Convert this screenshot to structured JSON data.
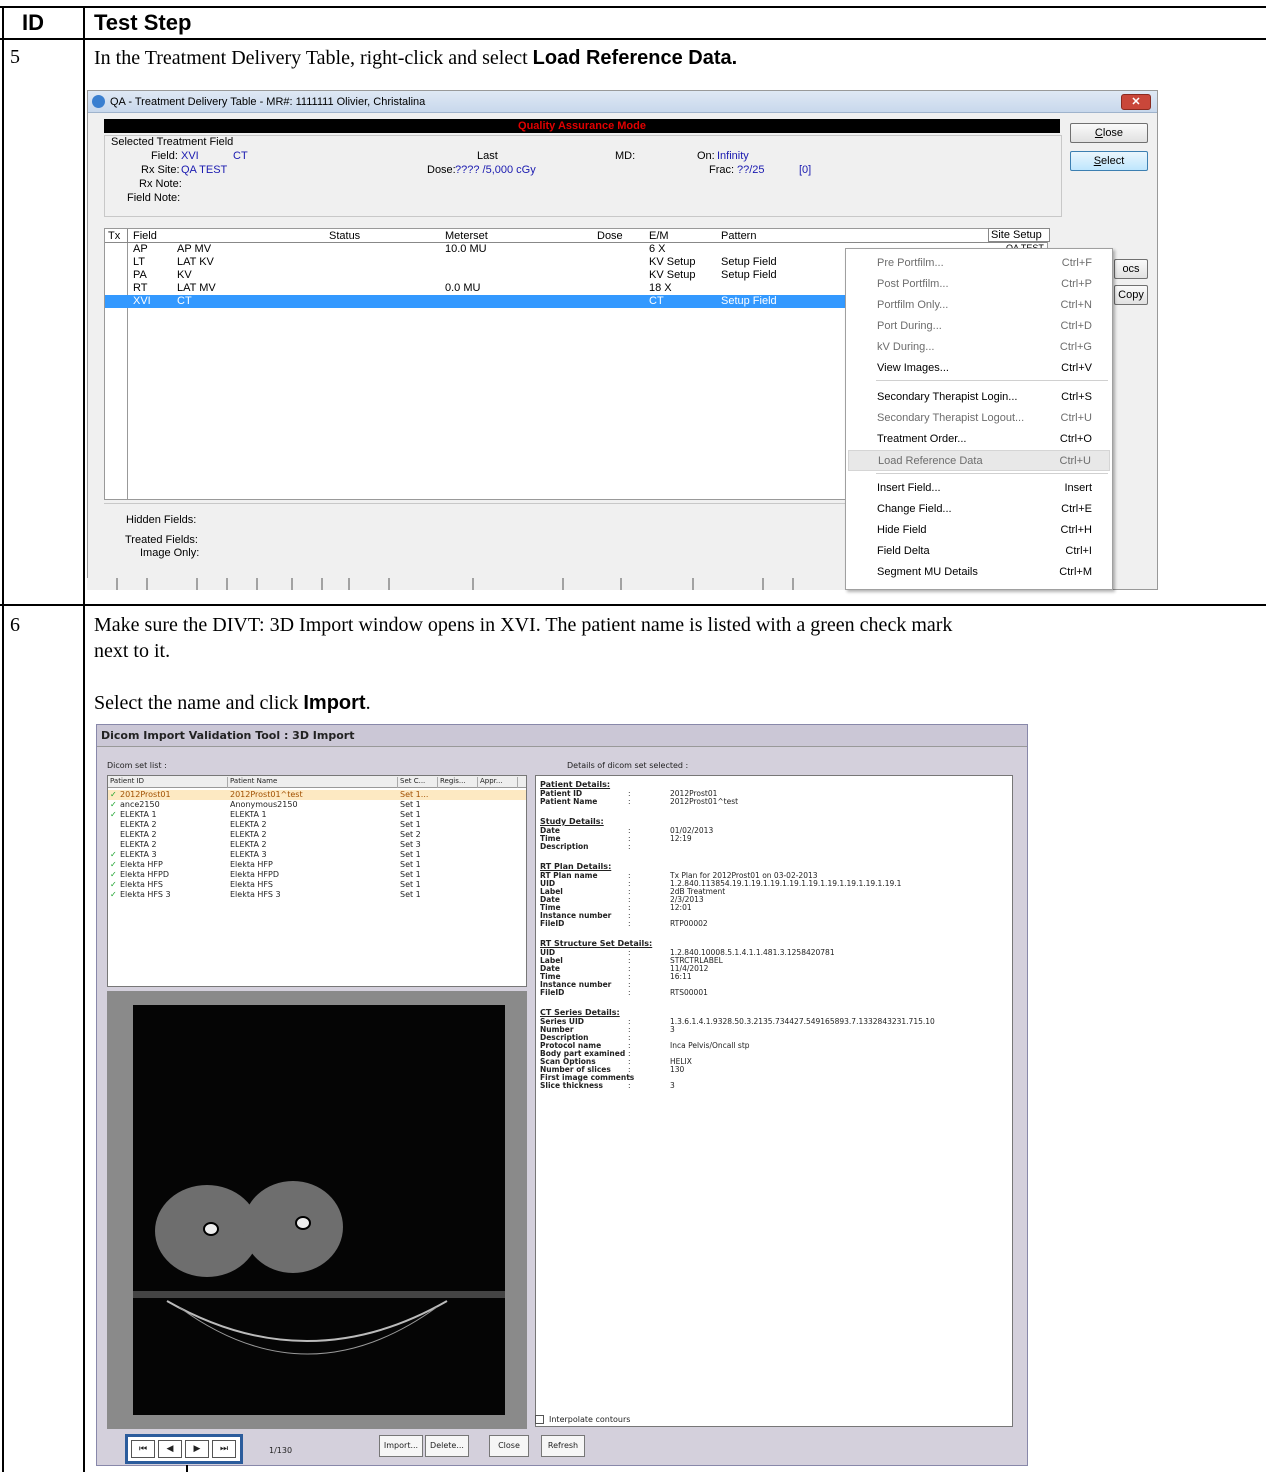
{
  "table": {
    "col_id": "ID",
    "col_step": "Test Step"
  },
  "step5": {
    "id": "5",
    "text": "In the Treatment Delivery Table, right-click and select ",
    "bold": "Load Reference Data."
  },
  "step6": {
    "id": "6",
    "text1": "Make sure the DIVT: 3D Import window opens in XVI. The patient name is listed with a green check mark",
    "text2": "next to it.",
    "text3a": "Select the name and click ",
    "text3b": "Import",
    "text3c": "."
  },
  "win1": {
    "title": "QA - Treatment Delivery Table - MR#: 1111111  Olivier, Christalina",
    "qa_mode": "Quality Assurance Mode",
    "selected_field_label": "Selected Treatment Field",
    "field_label": "Field:",
    "field_val": "XVI",
    "field_val2": "CT",
    "last_label": "Last",
    "md_label": "MD:",
    "on_label": "On:",
    "on_val": "Infinity",
    "rxsite_label": "Rx Site:",
    "rxsite_val": "QA TEST",
    "dose_label": "Dose:",
    "dose_val": "???? /5,000 cGy",
    "frac_label": "Frac:",
    "frac_val": "??/25",
    "frac_extra": "[0]",
    "rxnote_label": "Rx Note:",
    "fieldnote_label": "Field Note:",
    "close_btn": "Close",
    "select_btn": "Select",
    "docs_btn": "ocs",
    "copy_btn": "Copy",
    "columns": [
      "Tx",
      "Field",
      "Status",
      "Meterset",
      "Dose",
      "E/M",
      "Pattern"
    ],
    "site_setup": "Site Setup",
    "site_setup_val": "QA TEST",
    "rows": [
      {
        "field": "AP",
        "name": "AP MV",
        "meterset": "10.0 MU",
        "em": "6 X",
        "pattern": ""
      },
      {
        "field": "LT",
        "name": "LAT KV",
        "meterset": "",
        "em": "KV Setup",
        "pattern": "Setup Field"
      },
      {
        "field": "PA",
        "name": "KV",
        "meterset": "",
        "em": "KV Setup",
        "pattern": "Setup Field"
      },
      {
        "field": "RT",
        "name": "LAT MV",
        "meterset": "0.0 MU",
        "em": "18 X",
        "pattern": ""
      },
      {
        "field": "XVI",
        "name": "CT",
        "meterset": "",
        "em": "CT",
        "pattern": "Setup Field"
      }
    ],
    "hidden_fields": "Hidden Fields:",
    "treated_fields": "Treated Fields:",
    "image_only": "Image Only:"
  },
  "menu": [
    {
      "label": "Pre Portfilm...",
      "shortcut": "Ctrl+F",
      "disabled": true
    },
    {
      "label": "Post Portfilm...",
      "shortcut": "Ctrl+P",
      "disabled": true
    },
    {
      "label": "Portfilm Only...",
      "shortcut": "Ctrl+N",
      "disabled": true
    },
    {
      "label": "Port During...",
      "shortcut": "Ctrl+D",
      "disabled": true
    },
    {
      "label": "kV During...",
      "shortcut": "Ctrl+G",
      "disabled": true
    },
    {
      "label": "View Images...",
      "shortcut": "Ctrl+V",
      "disabled": false
    },
    {
      "label": "Secondary Therapist Login...",
      "shortcut": "Ctrl+S",
      "disabled": false
    },
    {
      "label": "Secondary Therapist Logout...",
      "shortcut": "Ctrl+U",
      "disabled": true
    },
    {
      "label": "Treatment Order...",
      "shortcut": "Ctrl+O",
      "disabled": false
    },
    {
      "label": "Load Reference Data",
      "shortcut": "Ctrl+U",
      "disabled": true
    },
    {
      "label": "Insert Field...",
      "shortcut": "Insert",
      "disabled": false
    },
    {
      "label": "Change Field...",
      "shortcut": "Ctrl+E",
      "disabled": false
    },
    {
      "label": "Hide Field",
      "shortcut": "Ctrl+H",
      "disabled": false
    },
    {
      "label": "Field Delta",
      "shortcut": "Ctrl+I",
      "disabled": false
    },
    {
      "label": "Segment MU Details",
      "shortcut": "Ctrl+M",
      "disabled": false
    }
  ],
  "win2": {
    "title": "Dicom Import Validation Tool : 3D Import",
    "set_list_label": "Dicom set list :",
    "details_label": "Details of dicom set selected :",
    "list_columns": [
      "Patient ID",
      "Patient Name",
      "Set C...",
      "Regis...",
      "Appr..."
    ],
    "list_rows": [
      {
        "check": true,
        "id": "2012Prost01",
        "name": "2012Prost01^test",
        "set": "Set 1...",
        "hi": true
      },
      {
        "check": true,
        "id": "ance2150",
        "name": "Anonymous2150",
        "set": "Set 1",
        "hi": false
      },
      {
        "check": true,
        "id": "ELEKTA 1",
        "name": "ELEKTA 1",
        "set": "Set 1",
        "hi": false
      },
      {
        "check": false,
        "id": "ELEKTA 2",
        "name": "ELEKTA 2",
        "set": "Set 1",
        "hi": false
      },
      {
        "check": false,
        "id": "ELEKTA 2",
        "name": "ELEKTA 2",
        "set": "Set 2",
        "hi": false
      },
      {
        "check": false,
        "id": "ELEKTA 2",
        "name": "ELEKTA 2",
        "set": "Set 3",
        "hi": false
      },
      {
        "check": true,
        "id": "ELEKTA 3",
        "name": "ELEKTA 3",
        "set": "Set 1",
        "hi": false
      },
      {
        "check": true,
        "id": "Elekta HFP",
        "name": "Elekta HFP",
        "set": "Set 1",
        "hi": false
      },
      {
        "check": true,
        "id": "Elekta HFPD",
        "name": "Elekta HFPD",
        "set": "Set 1",
        "hi": false
      },
      {
        "check": true,
        "id": "Elekta HFS",
        "name": "Elekta HFS",
        "set": "Set 1",
        "hi": false
      },
      {
        "check": true,
        "id": "Elekta HFS 3",
        "name": "Elekta HFS 3",
        "set": "Set 1",
        "hi": false
      }
    ],
    "details": {
      "patient_head": "Patient Details:",
      "patient": [
        {
          "k": "Patient ID",
          "v": "2012Prost01"
        },
        {
          "k": "Patient Name",
          "v": "2012Prost01^test"
        }
      ],
      "study_head": "Study Details:",
      "study": [
        {
          "k": "Date",
          "v": "01/02/2013"
        },
        {
          "k": "Time",
          "v": "12:19"
        },
        {
          "k": "Description",
          "v": ""
        }
      ],
      "rtplan_head": "RT Plan Details:",
      "rtplan": [
        {
          "k": "RT Plan name",
          "v": "Tx Plan for 2012Prost01 on 03-02-2013"
        },
        {
          "k": "UID",
          "v": "1.2.840.113854.19.1.19.1.19.1.19.1.19.1.19.1.19.1.19.1.19.1"
        },
        {
          "k": "Label",
          "v": "2dB Treatment"
        },
        {
          "k": "Date",
          "v": "2/3/2013"
        },
        {
          "k": "Time",
          "v": "12:01"
        },
        {
          "k": "Instance number",
          "v": ""
        },
        {
          "k": "FileID",
          "v": "RTP00002"
        }
      ],
      "rtstruct_head": "RT Structure Set Details:",
      "rtstruct": [
        {
          "k": "UID",
          "v": "1.2.840.10008.5.1.4.1.1.481.3.1258420781"
        },
        {
          "k": "Label",
          "v": "STRCTRLABEL"
        },
        {
          "k": "Date",
          "v": "11/4/2012"
        },
        {
          "k": "Time",
          "v": "16:11"
        },
        {
          "k": "Instance number",
          "v": ""
        },
        {
          "k": "FileID",
          "v": "RTS00001"
        }
      ],
      "ct_head": "CT Series Details:",
      "ct": [
        {
          "k": "Series UID",
          "v": "1.3.6.1.4.1.9328.50.3.2135.734427.549165893.7.1332843231.715.10"
        },
        {
          "k": "Number",
          "v": "3"
        },
        {
          "k": "Description",
          "v": ""
        },
        {
          "k": "Protocol name",
          "v": "Inca Pelvis/Oncall stp"
        },
        {
          "k": "Body part examined",
          "v": ""
        },
        {
          "k": "Scan Options",
          "v": "HELIX"
        },
        {
          "k": "Number of slices",
          "v": "130"
        },
        {
          "k": "First image comments",
          "v": ""
        },
        {
          "k": "Slice thickness",
          "v": "3"
        }
      ]
    },
    "interpolate": "Interpolate contours",
    "slice_counter": "1/130",
    "import_btn": "Import...",
    "delete_btn": "Delete...",
    "close_btn": "Close",
    "refresh_btn": "Refresh",
    "nav": [
      "⏮",
      "◀",
      "▶",
      "⏭"
    ]
  }
}
